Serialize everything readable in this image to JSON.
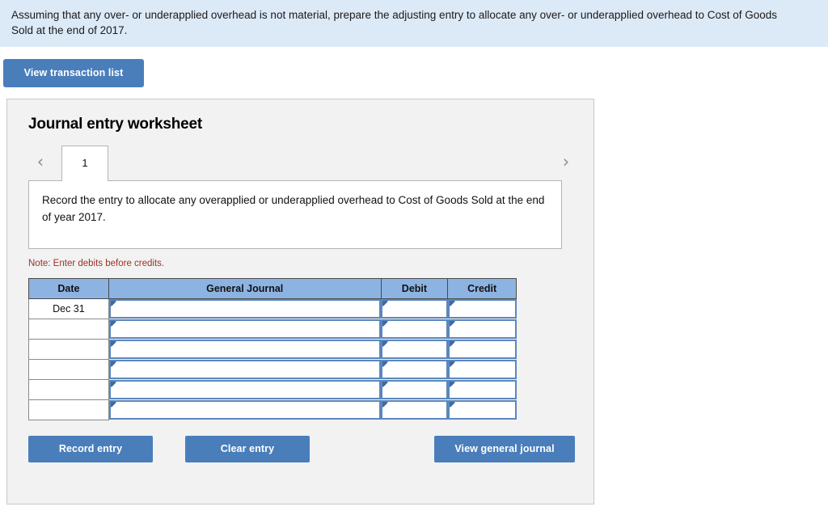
{
  "instruction": {
    "text": "Assuming that any over- or underapplied overhead is not material, prepare the adjusting entry to allocate any over- or underapplied overhead to Cost of Goods Sold at the end of 2017."
  },
  "toolbar": {
    "view_transaction_list_label": "View transaction list"
  },
  "worksheet": {
    "title": "Journal entry worksheet",
    "tabs": [
      {
        "label": "1",
        "active": true
      }
    ],
    "nav": {
      "prev_icon": "‹",
      "next_icon": "›"
    },
    "description": "Record the entry to allocate any overapplied or underapplied overhead to Cost of Goods Sold at the end of year 2017.",
    "note": "Note: Enter debits before credits.",
    "table": {
      "columns": [
        "Date",
        "General Journal",
        "Debit",
        "Credit"
      ],
      "rows": [
        {
          "date": "Dec 31",
          "general_journal": "",
          "debit": "",
          "credit": ""
        },
        {
          "date": "",
          "general_journal": "",
          "debit": "",
          "credit": ""
        },
        {
          "date": "",
          "general_journal": "",
          "debit": "",
          "credit": ""
        },
        {
          "date": "",
          "general_journal": "",
          "debit": "",
          "credit": ""
        },
        {
          "date": "",
          "general_journal": "",
          "debit": "",
          "credit": ""
        },
        {
          "date": "",
          "general_journal": "",
          "debit": "",
          "credit": ""
        }
      ]
    },
    "actions": {
      "record_entry_label": "Record entry",
      "clear_entry_label": "Clear entry",
      "view_general_journal_label": "View general journal"
    }
  },
  "colors": {
    "banner_bg": "#dce9f7",
    "button_blue": "#4a7ebb",
    "table_header_blue": "#8db3e2",
    "note_red": "#9c3025",
    "panel_bg": "#f2f2f2",
    "input_border_blue": "#5b87bd"
  }
}
